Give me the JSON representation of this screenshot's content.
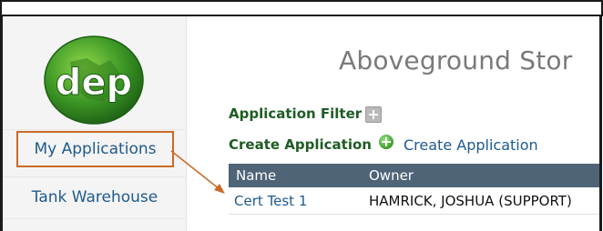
{
  "colors": {
    "nav_link": "#1f5a8c",
    "section_label": "#1e5c24",
    "grid_header_bg": "#4f6477",
    "callout": "#c96a27",
    "title": "#7a7a7a"
  },
  "logo": {
    "text": "dep",
    "icon": "dep-logo-icon"
  },
  "sidebar": {
    "items": [
      {
        "label": "My Applications",
        "selected": true
      },
      {
        "label": "Tank Warehouse",
        "selected": false
      }
    ]
  },
  "main": {
    "title": "Aboveground Stor",
    "filter": {
      "label": "Application Filter",
      "icon": "expand-plus-icon"
    },
    "create": {
      "label": "Create Application",
      "icon": "green-plus-icon",
      "link": "Create Application"
    },
    "table": {
      "columns": [
        "Name",
        "Owner"
      ],
      "rows": [
        {
          "name": "Cert Test 1",
          "owner": "HAMRICK, JOSHUA (SUPPORT)"
        }
      ]
    }
  }
}
